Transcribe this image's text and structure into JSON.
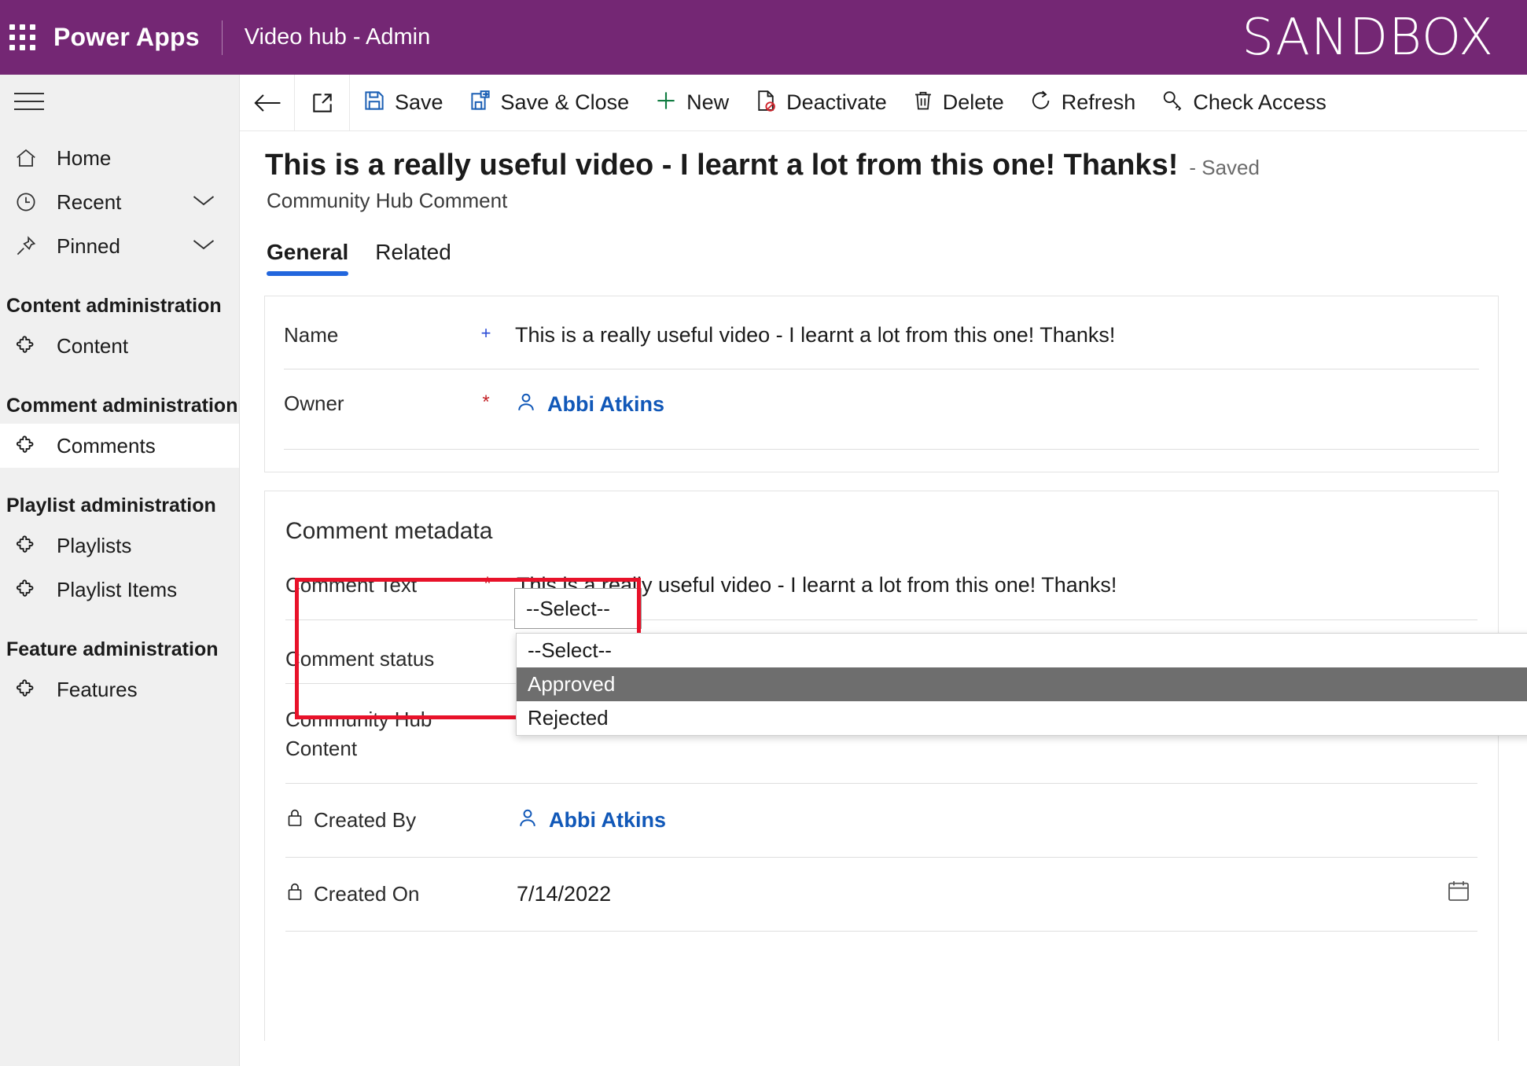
{
  "header": {
    "waffle_icon": "waffle-grid-icon",
    "brand": "Power Apps",
    "app_name": "Video hub - Admin",
    "environment_badge": "SANDBOX",
    "bg_color": "#742774"
  },
  "sidebar": {
    "hamburger_icon": "hamburger-menu-icon",
    "nav": [
      {
        "label": "Home",
        "icon": "home-icon",
        "expandable": false,
        "selected": false
      },
      {
        "label": "Recent",
        "icon": "clock-icon",
        "expandable": true,
        "selected": false
      },
      {
        "label": "Pinned",
        "icon": "pin-icon",
        "expandable": true,
        "selected": false
      }
    ],
    "groups": [
      {
        "title": "Content administration",
        "items": [
          {
            "label": "Content",
            "icon": "puzzle-piece-icon",
            "selected": false
          }
        ]
      },
      {
        "title": "Comment administration",
        "items": [
          {
            "label": "Comments",
            "icon": "puzzle-piece-icon",
            "selected": true
          }
        ]
      },
      {
        "title": "Playlist administration",
        "items": [
          {
            "label": "Playlists",
            "icon": "puzzle-piece-icon",
            "selected": false
          },
          {
            "label": "Playlist Items",
            "icon": "puzzle-piece-icon",
            "selected": false
          }
        ]
      },
      {
        "title": "Feature administration",
        "items": [
          {
            "label": "Features",
            "icon": "puzzle-piece-icon",
            "selected": false
          }
        ]
      }
    ]
  },
  "commandbar": {
    "back_icon": "back-arrow-icon",
    "popout_icon": "open-in-new-window-icon",
    "buttons": [
      {
        "label": "Save",
        "icon": "save-floppy-icon"
      },
      {
        "label": "Save & Close",
        "icon": "save-and-close-icon"
      },
      {
        "label": "New",
        "icon": "plus-icon"
      },
      {
        "label": "Deactivate",
        "icon": "deactivate-icon"
      },
      {
        "label": "Delete",
        "icon": "trash-icon"
      },
      {
        "label": "Refresh",
        "icon": "refresh-icon"
      },
      {
        "label": "Check Access",
        "icon": "key-icon"
      }
    ]
  },
  "record": {
    "title": "This is a really useful video - I learnt a lot from this one! Thanks!",
    "status_suffix": "- Saved",
    "entity_name": "Community Hub Comment"
  },
  "tabs": [
    {
      "label": "General",
      "active": true
    },
    {
      "label": "Related",
      "active": false
    }
  ],
  "general_section": {
    "fields": [
      {
        "label": "Name",
        "required_marker": "+",
        "marker_type": "recommended",
        "value": "This is a really useful video - I learnt a lot from this one! Thanks!"
      },
      {
        "label": "Owner",
        "required_marker": "*",
        "marker_type": "required",
        "value": "Abbi Atkins",
        "icon": "person-icon",
        "is_link": true
      }
    ]
  },
  "metadata_section": {
    "heading": "Comment metadata",
    "comment_text": {
      "label": "Comment Text",
      "required_marker": "*",
      "value": "This is a really useful video - I learnt a lot from this one! Thanks!"
    },
    "comment_status": {
      "label": "Comment status",
      "selected_value": "--Select--",
      "options": [
        {
          "label": "--Select--",
          "highlighted": false
        },
        {
          "label": "Approved",
          "highlighted": true
        },
        {
          "label": "Rejected",
          "highlighted": false
        }
      ],
      "chevron_icon": "chevron-down-icon"
    },
    "community_hub_content": {
      "label_line1": "Community Hub",
      "label_line2": "Content",
      "value": ""
    },
    "created_by": {
      "label": "Created By",
      "lock_icon": "lock-icon",
      "value": "Abbi Atkins",
      "icon": "person-icon",
      "is_link": true
    },
    "created_on": {
      "label": "Created On",
      "lock_icon": "lock-icon",
      "value": "7/14/2022",
      "calendar_icon": "calendar-icon"
    }
  },
  "annotation": {
    "highlight_color": "#e8122a",
    "shape": "rectangle"
  }
}
